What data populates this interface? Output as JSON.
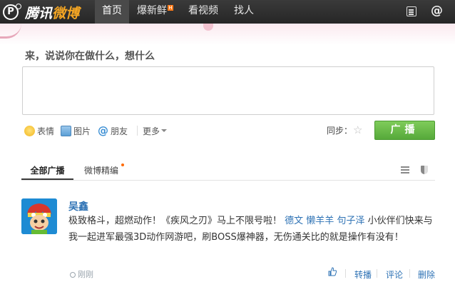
{
  "topbar": {
    "logo_mark": "P",
    "logo_text_a": "腾讯",
    "logo_text_b": "微博",
    "nav": {
      "home": "首页",
      "hot": "爆新鲜",
      "hot_badge": "H",
      "video": "看视频",
      "find": "找人"
    },
    "at_symbol": "@",
    "icons": {
      "messages": "list-icon",
      "mentions": "at-icon"
    }
  },
  "composer": {
    "prompt": "来，说说你在做什么，想什么",
    "text_value": "",
    "tools": {
      "emoji": "表情",
      "picture": "图片",
      "friend_at": "@",
      "friend": "朋友",
      "more": "更多"
    },
    "sync_label": "同步：",
    "broadcast_button": "广播"
  },
  "tabs": {
    "all": "全部广播",
    "best": "微博精编"
  },
  "feed": {
    "post": {
      "username": "吴鑫",
      "text_a": "极致格斗，超燃动作！《疾风之刃》马上不限号啦！",
      "mentions": [
        "德文",
        "懒羊羊",
        "句子泽"
      ],
      "text_b": "小伙伴们快来与我一起进军最强3D动作网游吧，刷BOSS爆神器，无伤通关比的就是操作有没有！",
      "time": "刚刚",
      "actions": {
        "repost": "转播",
        "comment": "评论",
        "delete": "删除"
      }
    }
  },
  "colors": {
    "accent_green": "#5fb243",
    "link_blue": "#2f73b5",
    "topbar": "#2e2e2e"
  }
}
